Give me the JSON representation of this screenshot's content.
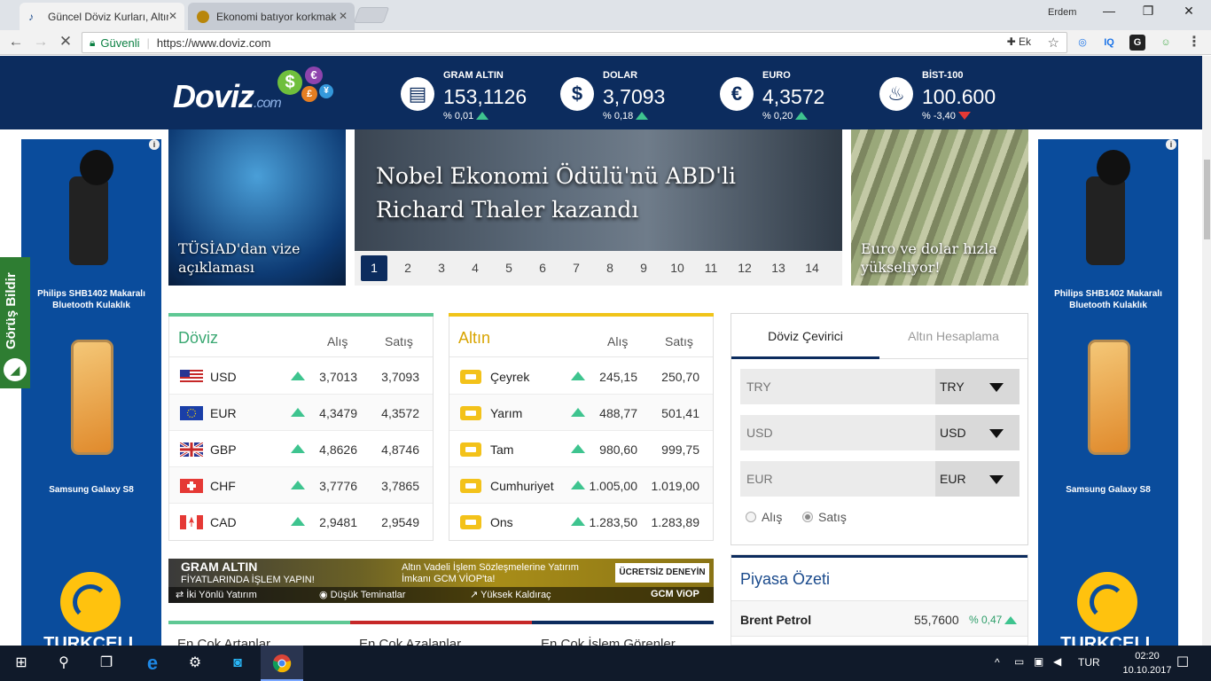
{
  "browser": {
    "tabs": [
      {
        "title": "Güncel Döviz Kurları, Altın"
      },
      {
        "title": "Ekonomi batıyor korkmak"
      }
    ],
    "user": "Erdem",
    "secure_label": "Güvenli",
    "url": "https://www.doviz.com",
    "ext_label": "Ek",
    "ext_iq": "IQ"
  },
  "header": {
    "logo_main": "Doviz",
    "logo_suffix": ".com",
    "rates": [
      {
        "name": "GRAM ALTIN",
        "value": "153,1126",
        "change": "% 0,01",
        "dir": "up",
        "icon": "gold-bar-icon"
      },
      {
        "name": "DOLAR",
        "value": "3,7093",
        "change": "% 0,18",
        "dir": "up",
        "icon": "dollar-icon"
      },
      {
        "name": "EURO",
        "value": "4,3572",
        "change": "% 0,20",
        "dir": "up",
        "icon": "euro-icon"
      },
      {
        "name": "BİST-100",
        "value": "100.600",
        "change": "% -3,40",
        "dir": "down",
        "icon": "flame-icon"
      }
    ]
  },
  "ads": {
    "headset": "Philips SHB1402 Makaralı Bluetooth Kulaklık",
    "phone": "Samsung Galaxy S8",
    "brand": "TURKCELL"
  },
  "feedback": "Görüş Bildir",
  "news": {
    "left": "TÜSİAD'dan vize açıklaması",
    "main": "Nobel Ekonomi Ödülü'nü ABD'li Richard Thaler kazandı",
    "right": "Euro ve dolar hızla yükseliyor!",
    "pages": [
      "1",
      "2",
      "3",
      "4",
      "5",
      "6",
      "7",
      "8",
      "9",
      "10",
      "11",
      "12",
      "13",
      "14"
    ]
  },
  "currency_table": {
    "title": "Döviz",
    "buy": "Alış",
    "sell": "Satış",
    "rows": [
      {
        "code": "USD",
        "buy": "3,7013",
        "sell": "3,7093"
      },
      {
        "code": "EUR",
        "buy": "4,3479",
        "sell": "4,3572"
      },
      {
        "code": "GBP",
        "buy": "4,8626",
        "sell": "4,8746"
      },
      {
        "code": "CHF",
        "buy": "3,7776",
        "sell": "3,7865"
      },
      {
        "code": "CAD",
        "buy": "2,9481",
        "sell": "2,9549"
      }
    ]
  },
  "gold_table": {
    "title": "Altın",
    "buy": "Alış",
    "sell": "Satış",
    "rows": [
      {
        "code": "Çeyrek",
        "buy": "245,15",
        "sell": "250,70"
      },
      {
        "code": "Yarım",
        "buy": "488,77",
        "sell": "501,41"
      },
      {
        "code": "Tam",
        "buy": "980,60",
        "sell": "999,75"
      },
      {
        "code": "Cumhuriyet",
        "buy": "1.005,00",
        "sell": "1.019,00"
      },
      {
        "code": "Ons",
        "buy": "1.283,50",
        "sell": "1.283,89"
      }
    ]
  },
  "converter": {
    "tab_active": "Döviz Çevirici",
    "tab_other": "Altın Hesaplama",
    "fields": [
      {
        "placeholder": "TRY",
        "currency": "TRY"
      },
      {
        "placeholder": "USD",
        "currency": "USD"
      },
      {
        "placeholder": "EUR",
        "currency": "EUR"
      }
    ],
    "radio_buy": "Alış",
    "radio_sell": "Satış"
  },
  "banner": {
    "title": "GRAM ALTIN",
    "subtitle": "FİYATLARINDA İŞLEM YAPIN!",
    "text": "Altın Vadeli İşlem Sözleşmelerine Yatırım İmkanı GCM VİOP'ta!",
    "button": "ÜCRETSİZ DENEYİN",
    "f1": "İki Yönlü Yatırım",
    "f2": "Düşük Teminatlar",
    "f3": "Yüksek Kaldıraç",
    "brand": "GCM ViOP"
  },
  "bottom_tabs": [
    "En Çok Artanlar",
    "En Çok Azalanlar",
    "En Çok İşlem Görenler"
  ],
  "market": {
    "title": "Piyasa Özeti",
    "rows": [
      {
        "name": "Brent Petrol",
        "value": "55,7600",
        "change": "% 0,47"
      }
    ]
  },
  "taskbar": {
    "lang": "TUR",
    "time": "02:20",
    "date": "10.10.2017"
  },
  "colors": {
    "brand_navy": "#0c2c5e",
    "currency_accent": "#5fc894",
    "gold_accent": "#f0c419",
    "up": "#3ec48f",
    "down": "#e53935"
  }
}
